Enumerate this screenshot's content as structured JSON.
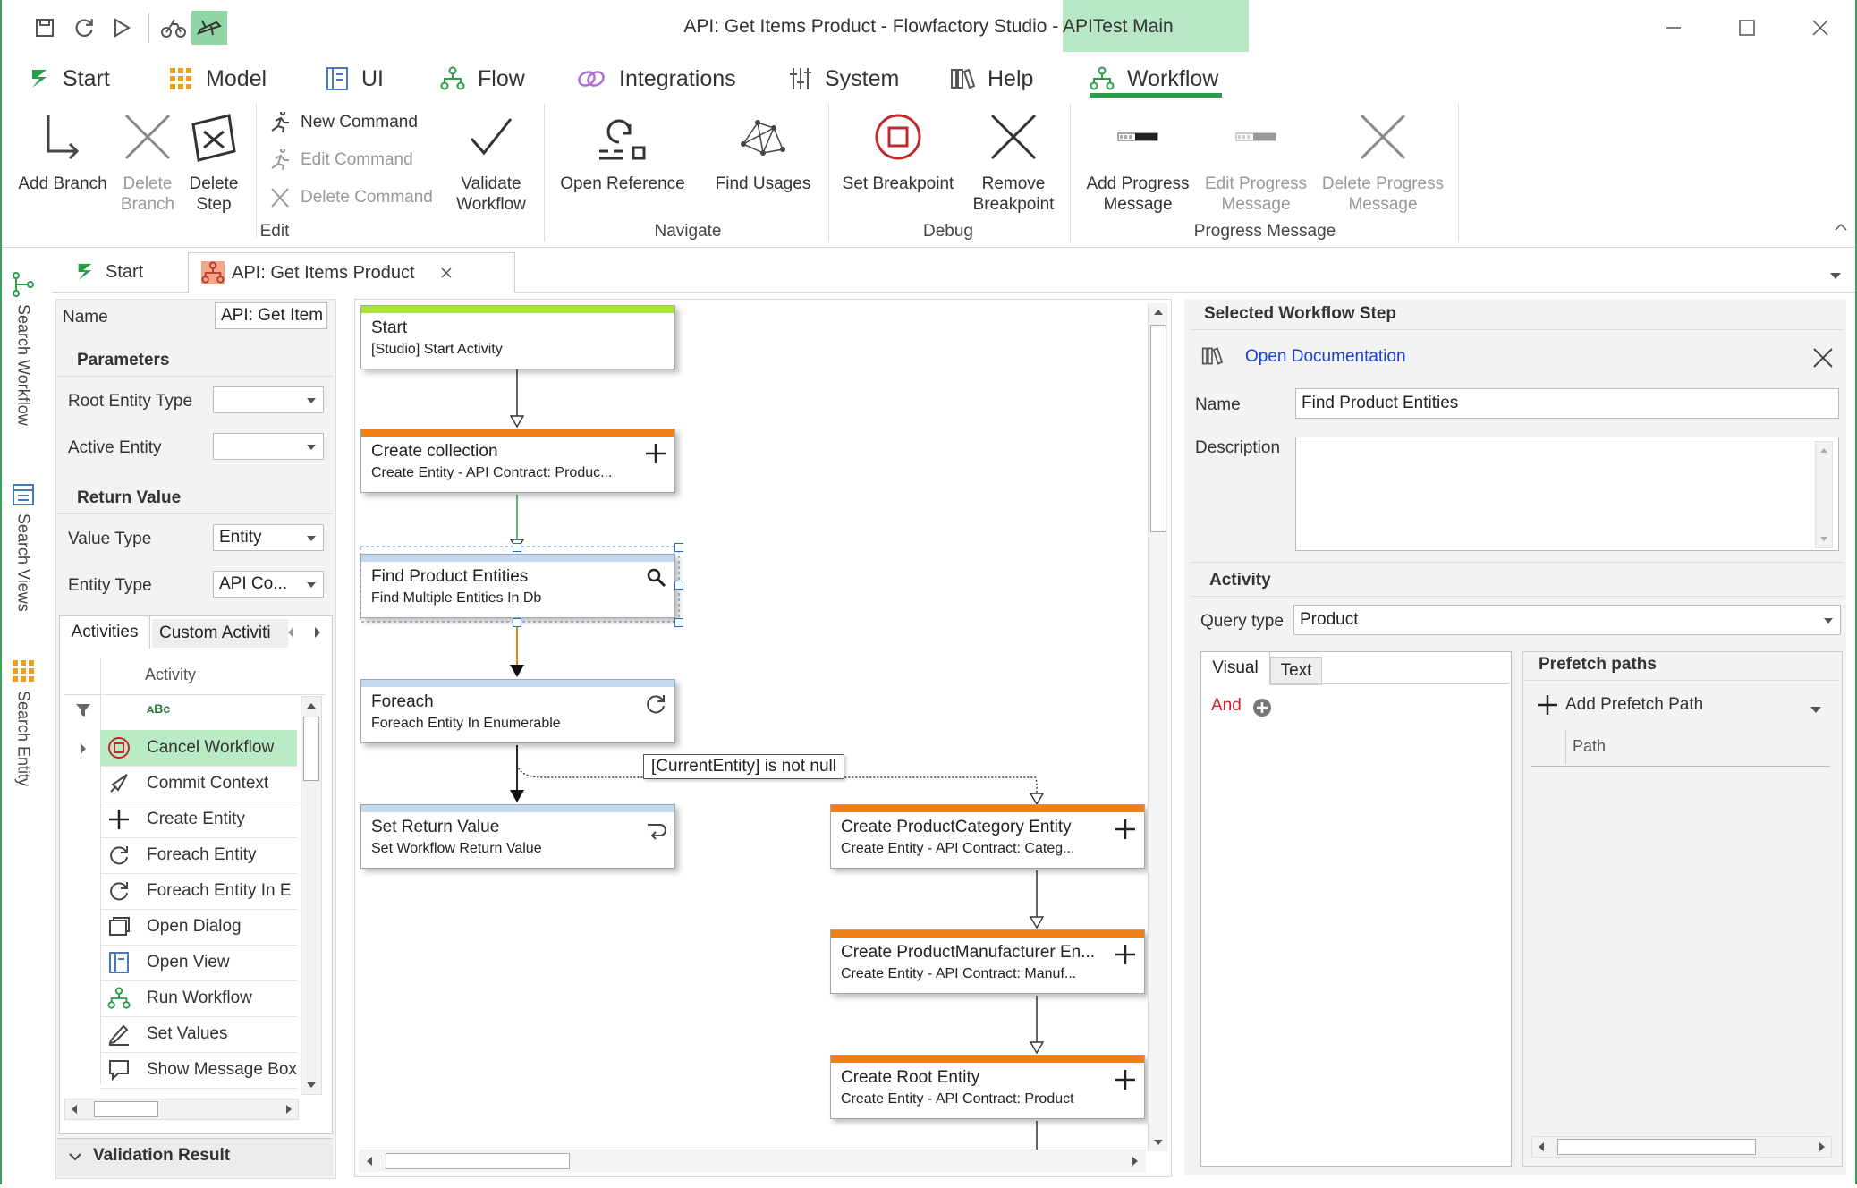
{
  "window": {
    "title": "API: Get Items Product  - Flowfactory Studio - APITest Main",
    "controls": [
      "minimize-icon",
      "maximize-icon",
      "close-icon"
    ]
  },
  "menu": [
    {
      "label": "Start",
      "icon": "start-icon"
    },
    {
      "label": "Model",
      "icon": "model-grid-icon"
    },
    {
      "label": "UI",
      "icon": "ui-icon"
    },
    {
      "label": "Flow",
      "icon": "flow-icon"
    },
    {
      "label": "Integrations",
      "icon": "integrations-icon"
    },
    {
      "label": "System",
      "icon": "system-icon"
    },
    {
      "label": "Help",
      "icon": "help-books-icon"
    },
    {
      "label": "Workflow",
      "icon": "workflow-icon",
      "active": true
    }
  ],
  "ribbon": {
    "edit": {
      "add_branch": "Add Branch",
      "delete_branch_1": "Delete",
      "delete_branch_2": "Branch",
      "delete_step_1": "Delete",
      "delete_step_2": "Step",
      "new_command": "New Command",
      "edit_command": "Edit Command",
      "delete_command": "Delete Command",
      "validate_1": "Validate",
      "validate_2": "Workflow",
      "group": "Edit"
    },
    "navigate": {
      "open_reference": "Open Reference",
      "find_usages": "Find Usages",
      "group": "Navigate"
    },
    "debug": {
      "set_breakpoint": "Set Breakpoint",
      "remove_bp_1": "Remove",
      "remove_bp_2": "Breakpoint",
      "group": "Debug"
    },
    "progress": {
      "add_1": "Add Progress",
      "add_2": "Message",
      "edit_1": "Edit Progress",
      "edit_2": "Message",
      "delete_1": "Delete Progress",
      "delete_2": "Message",
      "group": "Progress Message"
    }
  },
  "side_tabs": [
    "Search Workflow",
    "Search Views",
    "Search Entity"
  ],
  "doc_tabs": [
    {
      "label": "Start"
    },
    {
      "label": "API: Get Items Product",
      "active": true
    }
  ],
  "properties": {
    "name_label": "Name",
    "name_value": "API: Get Item",
    "parameters_header": "Parameters",
    "root_entity_type_label": "Root Entity Type",
    "root_entity_type_value": "",
    "active_entity_label": "Active Entity",
    "active_entity_value": "",
    "return_value_header": "Return Value",
    "value_type_label": "Value Type",
    "value_type_value": "Entity",
    "entity_type_label": "Entity Type",
    "entity_type_value": "API Co..."
  },
  "activities": {
    "tabs": [
      "Activities",
      "Custom Activiti"
    ],
    "column": "Activity",
    "filter_text": "ᴀBc",
    "items": [
      {
        "label": "Cancel Workflow",
        "icon": "stop-icon",
        "selected": true
      },
      {
        "label": "Commit Context",
        "icon": "rocket-icon"
      },
      {
        "label": "Create Entity",
        "icon": "plus-icon"
      },
      {
        "label": "Foreach Entity",
        "icon": "loop-icon"
      },
      {
        "label": "Foreach Entity In E",
        "icon": "loop-icon"
      },
      {
        "label": "Open Dialog",
        "icon": "dialog-icon"
      },
      {
        "label": "Open View",
        "icon": "view-icon"
      },
      {
        "label": "Run Workflow",
        "icon": "workflow-icon"
      },
      {
        "label": "Set Values",
        "icon": "pencil-icon"
      },
      {
        "label": "Show Message Box",
        "icon": "message-icon"
      }
    ],
    "validation_header": "Validation Result"
  },
  "workflow_nodes": [
    {
      "title": "Start",
      "subtitle": "[Studio] Start Activity",
      "color": "#a6e43a",
      "icon": ""
    },
    {
      "title": "Create collection",
      "subtitle": "Create Entity - API Contract: Produc...",
      "color": "#f07f16",
      "icon": "plus-icon"
    },
    {
      "title": "Find Product Entities",
      "subtitle": "Find Multiple Entities In Db",
      "color": "#c5d9ef",
      "icon": "search-icon"
    },
    {
      "title": "Foreach",
      "subtitle": "Foreach Entity In Enumerable",
      "color": "#c5d9ef",
      "icon": "loop-icon"
    },
    {
      "title": "Set Return Value",
      "subtitle": "Set Workflow Return Value",
      "color": "#c5d9ef",
      "icon": "return-icon"
    },
    {
      "title": "Create ProductCategory Entity",
      "subtitle": "Create Entity - API Contract: Categ...",
      "color": "#f07f16",
      "icon": "plus-icon"
    },
    {
      "title": "Create ProductManufacturer En...",
      "subtitle": "Create Entity - API Contract: Manuf...",
      "color": "#f07f16",
      "icon": "plus-icon"
    },
    {
      "title": "Create Root Entity",
      "subtitle": "Create Entity - API Contract: Product",
      "color": "#f07f16",
      "icon": "plus-icon"
    }
  ],
  "condition_label": "[CurrentEntity] is not null",
  "selected_step": {
    "header": "Selected Workflow Step",
    "open_doc": "Open Documentation",
    "name_label": "Name",
    "name_value": "Find Product Entities",
    "description_label": "Description",
    "description_value": "",
    "activity_header": "Activity",
    "query_type_label": "Query type",
    "query_type_value": "Product",
    "tabs": [
      "Visual",
      "Text"
    ],
    "and_label": "And",
    "prefetch_header": "Prefetch paths",
    "add_prefetch": "Add Prefetch Path",
    "path_col": "Path"
  }
}
